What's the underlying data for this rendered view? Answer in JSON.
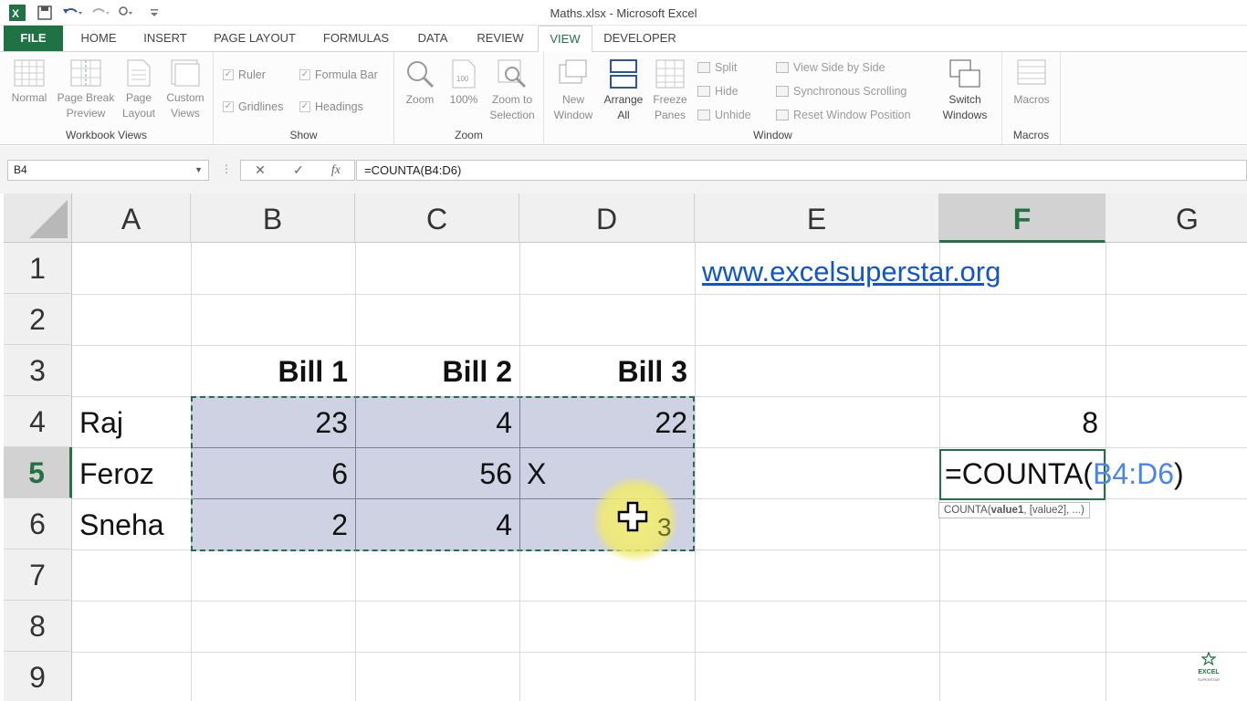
{
  "window": {
    "title": "Maths.xlsx - Microsoft Excel"
  },
  "tabs": [
    "FILE",
    "HOME",
    "INSERT",
    "PAGE LAYOUT",
    "FORMULAS",
    "DATA",
    "REVIEW",
    "VIEW",
    "DEVELOPER"
  ],
  "ribbon": {
    "workbook_views": {
      "label": "Workbook Views",
      "buttons": [
        [
          "Normal",
          ""
        ],
        [
          "Page Break",
          "Preview"
        ],
        [
          "Page",
          "Layout"
        ],
        [
          "Custom",
          "Views"
        ]
      ]
    },
    "show": {
      "label": "Show",
      "ruler": "Ruler",
      "formula_bar": "Formula Bar",
      "gridlines": "Gridlines",
      "headings": "Headings"
    },
    "zoom": {
      "label": "Zoom",
      "zoom": "Zoom",
      "hundred": "100%",
      "zoom_sel_1": "Zoom to",
      "zoom_sel_2": "Selection"
    },
    "window": {
      "label": "Window",
      "new_1": "New",
      "new_2": "Window",
      "arrange_1": "Arrange",
      "arrange_2": "All",
      "freeze_1": "Freeze",
      "freeze_2": "Panes",
      "split": "Split",
      "hide": "Hide",
      "unhide": "Unhide",
      "side_by_side": "View Side by Side",
      "sync_scroll": "Synchronous Scrolling",
      "reset_pos": "Reset Window Position",
      "switch_1": "Switch",
      "switch_2": "Windows"
    },
    "macros": {
      "label": "Macros",
      "button": "Macros"
    }
  },
  "formula_bar": {
    "name_box": "B4",
    "formula": "=COUNTA(B4:D6)",
    "fx": "fx"
  },
  "columns": [
    "A",
    "B",
    "C",
    "D",
    "E",
    "F",
    "G"
  ],
  "rows": [
    "1",
    "2",
    "3",
    "4",
    "5",
    "6",
    "7",
    "8",
    "9"
  ],
  "cells": {
    "E1": "www.excelsuperstar.org",
    "B3": "Bill 1",
    "C3": "Bill 2",
    "D3": "Bill 3",
    "A4": "Raj",
    "B4": "23",
    "C4": "4",
    "D4": "22",
    "F4": "8",
    "A5": "Feroz",
    "B5": "6",
    "C5": "56",
    "D5": "X",
    "A6": "Sneha",
    "B6": "2",
    "C6": "4",
    "F5_prefix": "=COUNTA(",
    "F5_ref": "B4:D6",
    "F5_suffix": ")"
  },
  "tooltip": {
    "fn": "COUNTA(",
    "arg1": "value1",
    "rest": ", [value2], ...)"
  },
  "cursor_count": "3",
  "watermark": {
    "line1": "EXCEL",
    "line2": "SUPERSTAR"
  },
  "colors": {
    "excel_green": "#217346",
    "selection_fill": "#b4bad2",
    "link": "#1155cc",
    "ref_blue": "#4a86e8"
  }
}
